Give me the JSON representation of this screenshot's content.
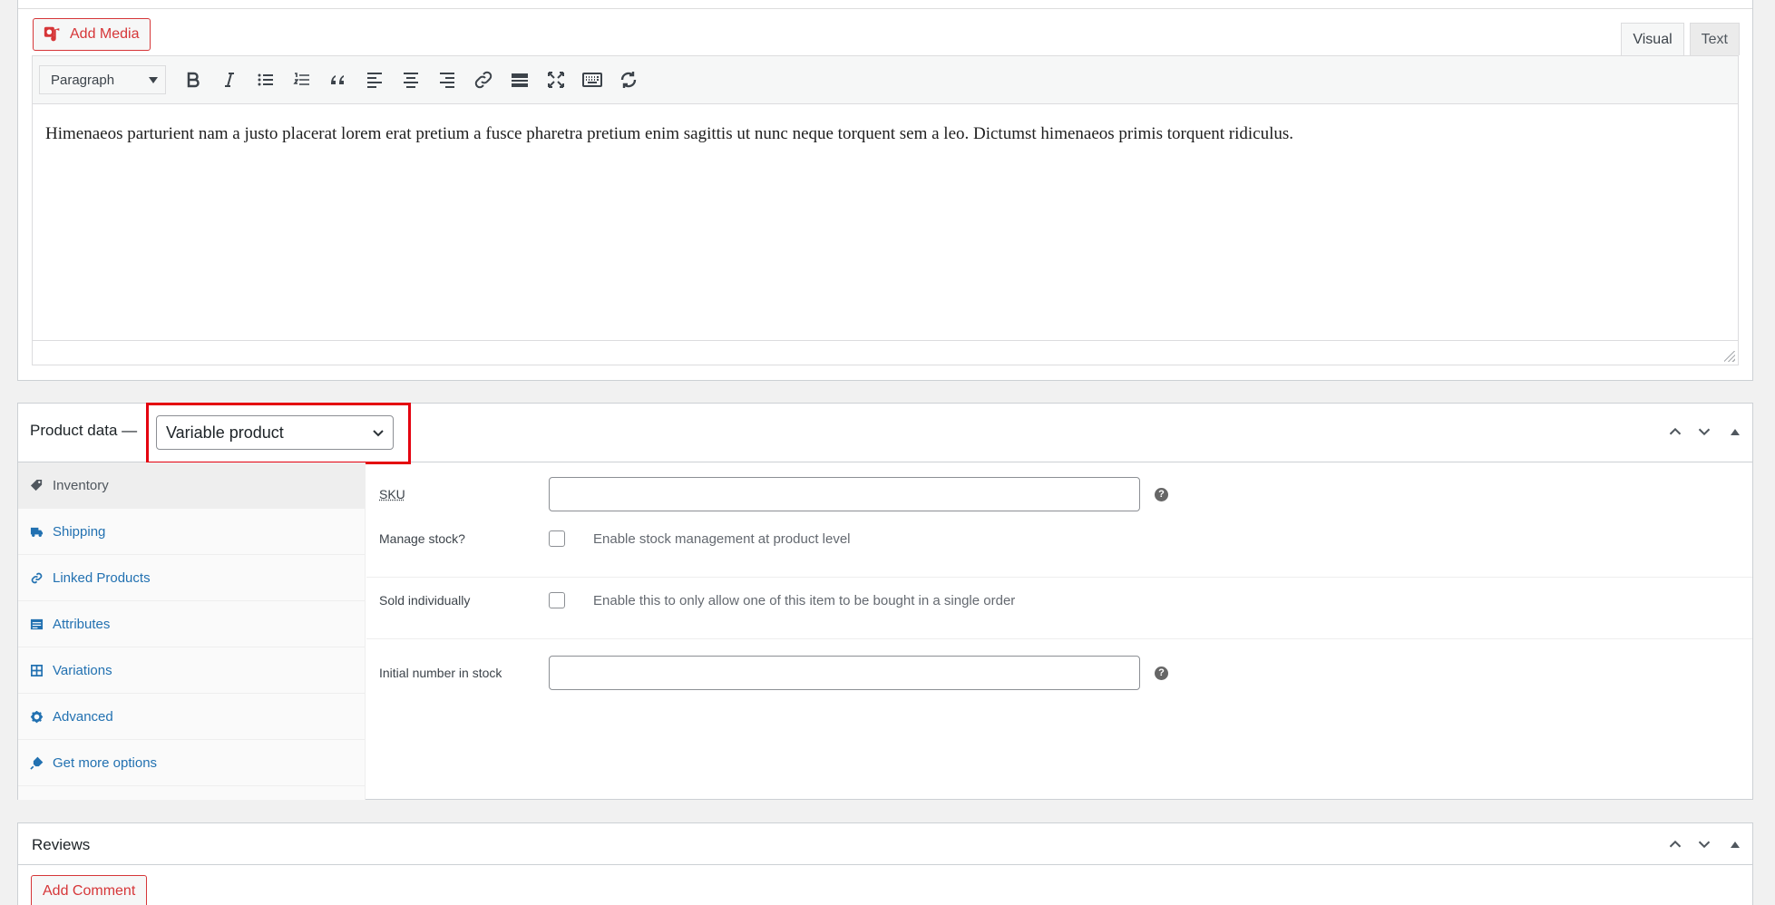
{
  "editor": {
    "add_media_label": "Add Media",
    "tabs": {
      "visual": "Visual",
      "text": "Text"
    },
    "format_select": "Paragraph",
    "content": "Himenaeos parturient nam a justo placerat lorem erat pretium a fusce pharetra pretium enim sagittis ut nunc neque torquent sem a leo. Dictumst himenaeos primis torquent ridiculus."
  },
  "product_data": {
    "title": "Product data —",
    "product_type": "Variable product",
    "tabs": [
      {
        "label": "Inventory",
        "icon": "tag-icon",
        "active": true
      },
      {
        "label": "Shipping",
        "icon": "truck-icon"
      },
      {
        "label": "Linked Products",
        "icon": "link-icon"
      },
      {
        "label": "Attributes",
        "icon": "list-icon"
      },
      {
        "label": "Variations",
        "icon": "grid-icon"
      },
      {
        "label": "Advanced",
        "icon": "gear-icon"
      },
      {
        "label": "Get more options",
        "icon": "plug-icon"
      }
    ],
    "fields": {
      "sku_label": "SKU",
      "manage_stock_label": "Manage stock?",
      "manage_stock_desc": "Enable stock management at product level",
      "sold_individually_label": "Sold individually",
      "sold_individually_desc": "Enable this to only allow one of this item to be bought in a single order",
      "initial_stock_label": "Initial number in stock",
      "help_glyph": "?"
    }
  },
  "reviews": {
    "title": "Reviews",
    "add_comment_label": "Add Comment"
  },
  "colors": {
    "accent": "#2271b1",
    "danger": "#d63638",
    "highlight": "#e4000f"
  }
}
